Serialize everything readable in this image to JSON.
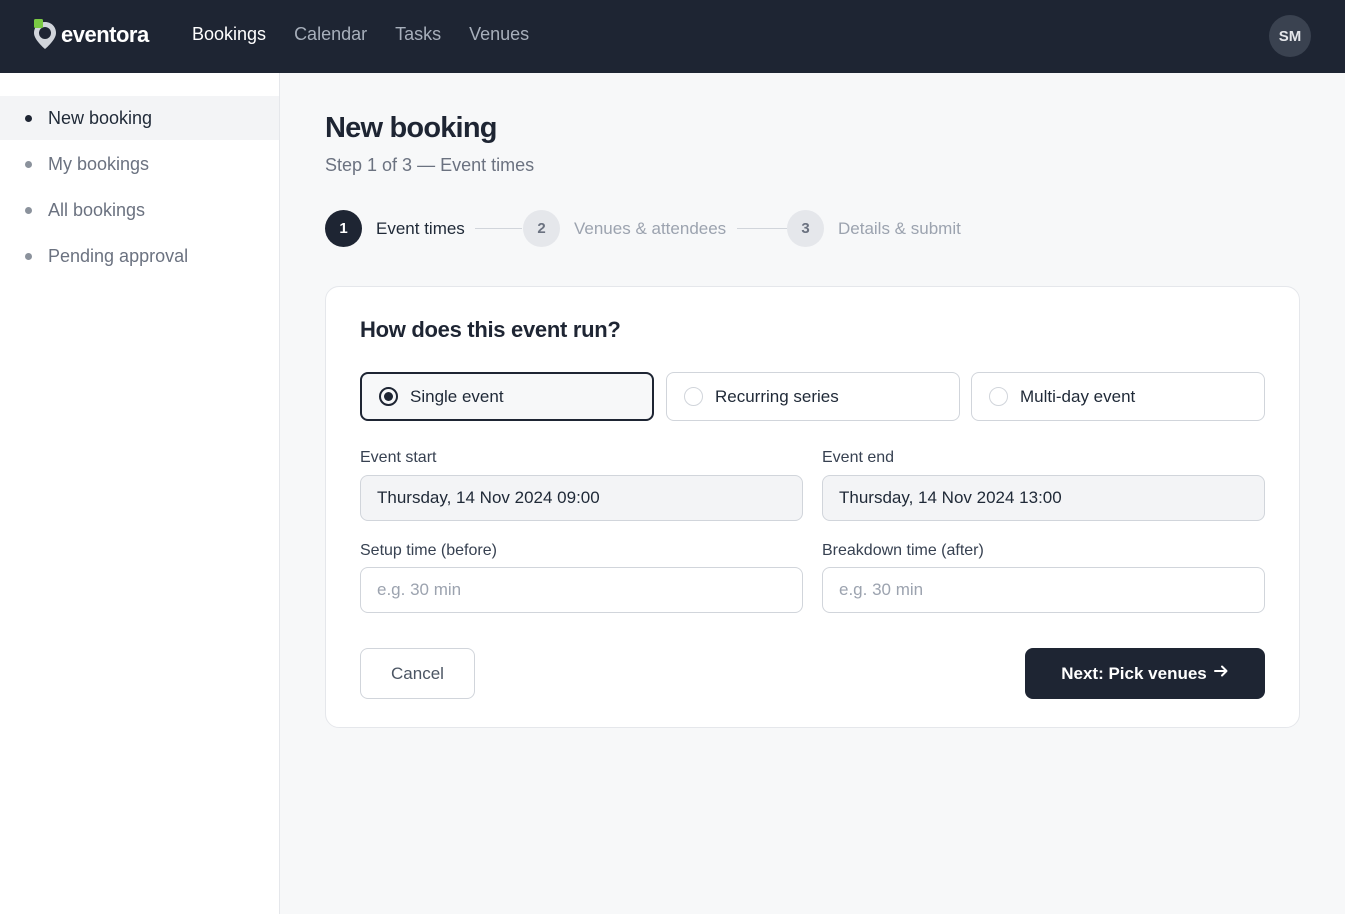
{
  "app": {
    "brand": "eventora",
    "accent_color": "#7ac943",
    "dark_color": "#1e2533"
  },
  "topnav": {
    "items": [
      {
        "label": "Bookings",
        "active": true
      },
      {
        "label": "Calendar",
        "active": false
      },
      {
        "label": "Tasks",
        "active": false
      },
      {
        "label": "Venues",
        "active": false
      }
    ],
    "avatar_initials": "SM"
  },
  "sidebar": {
    "items": [
      {
        "label": "New booking",
        "active": true
      },
      {
        "label": "My bookings",
        "active": false
      },
      {
        "label": "All bookings",
        "active": false
      },
      {
        "label": "Pending approval",
        "active": false
      }
    ]
  },
  "page": {
    "title": "New booking",
    "subtitle": "Step 1 of 3 — Event times"
  },
  "stepper": {
    "steps": [
      {
        "number": "1",
        "label": "Event times",
        "active": true
      },
      {
        "number": "2",
        "label": "Venues & attendees",
        "active": false
      },
      {
        "number": "3",
        "label": "Details & submit",
        "active": false
      }
    ]
  },
  "form": {
    "question": "How does this event run?",
    "options": [
      {
        "label": "Single event",
        "selected": true
      },
      {
        "label": "Recurring series",
        "selected": false
      },
      {
        "label": "Multi-day event",
        "selected": false
      }
    ],
    "event_start": {
      "label": "Event start",
      "value": "Thursday, 14 Nov 2024 09:00"
    },
    "event_end": {
      "label": "Event end",
      "value": "Thursday, 14 Nov 2024 13:00"
    },
    "setup_time": {
      "label": "Setup time (before)",
      "placeholder": "e.g. 30 min"
    },
    "breakdown_time": {
      "label": "Breakdown time (after)",
      "placeholder": "e.g. 30 min"
    },
    "cancel_label": "Cancel",
    "next_label": "Next: Pick venues",
    "next_icon": "arrow-right-icon"
  }
}
